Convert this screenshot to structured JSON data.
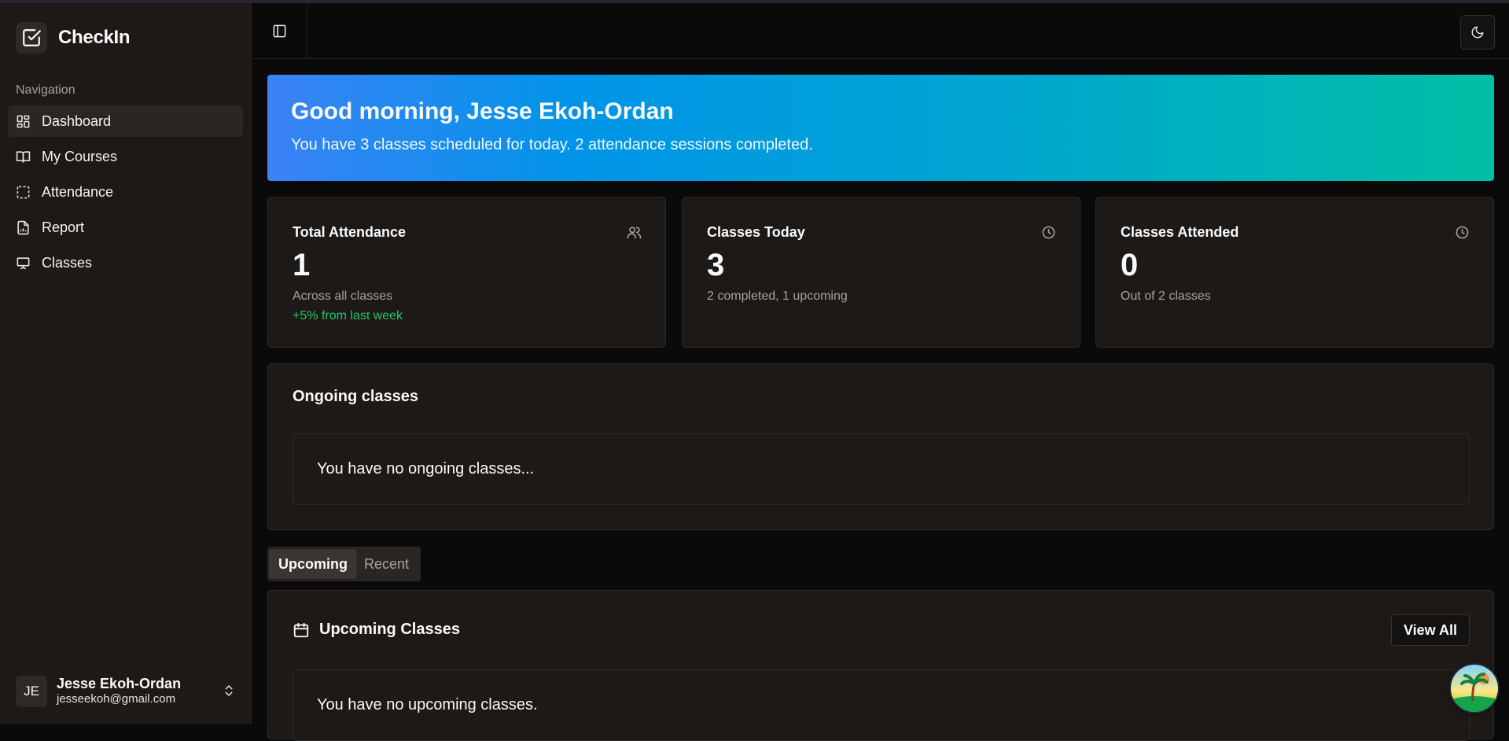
{
  "app": {
    "name": "CheckIn"
  },
  "sidebar": {
    "heading": "Navigation",
    "items": [
      {
        "label": "Dashboard",
        "icon": "layout-dashboard-icon",
        "active": true
      },
      {
        "label": "My Courses",
        "icon": "book-open-icon"
      },
      {
        "label": "Attendance",
        "icon": "dashed-square-icon"
      },
      {
        "label": "Report",
        "icon": "file-chart-icon"
      },
      {
        "label": "Classes",
        "icon": "presentation-icon"
      }
    ],
    "user": {
      "initials": "JE",
      "name": "Jesse Ekoh-Ordan",
      "email": "jesseekoh@gmail.com"
    }
  },
  "hero": {
    "title": "Good morning, Jesse Ekoh-Ordan",
    "subtitle": "You have 3 classes scheduled for today. 2 attendance sessions completed.",
    "gradient": [
      "#3b82f6",
      "#00bfa5"
    ]
  },
  "stats": [
    {
      "title": "Total Attendance",
      "value": "1",
      "desc": "Across all classes",
      "trend": "+5% from last week",
      "icon": "users-icon"
    },
    {
      "title": "Classes Today",
      "value": "3",
      "desc": "2 completed, 1 upcoming",
      "icon": "clock-icon"
    },
    {
      "title": "Classes Attended",
      "value": "0",
      "desc": "Out of 2 classes",
      "icon": "clock-icon"
    }
  ],
  "ongoing": {
    "title": "Ongoing classes",
    "empty": "You have no ongoing classes..."
  },
  "tabs": [
    {
      "label": "Upcoming",
      "active": true
    },
    {
      "label": "Recent"
    }
  ],
  "upcoming": {
    "title": "Upcoming Classes",
    "view_all": "View All",
    "empty": "You have no upcoming classes."
  },
  "colors": {
    "trend": "#22c55e",
    "sidebar_bg": "#1c1917",
    "page_bg": "#0a0a0a"
  }
}
